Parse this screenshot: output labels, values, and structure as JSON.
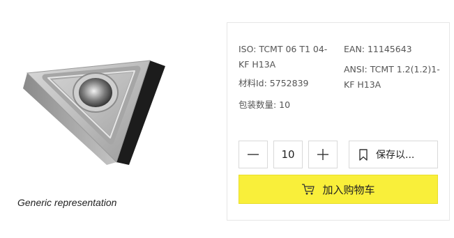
{
  "image": {
    "caption": "Generic representation"
  },
  "specs": {
    "iso": "ISO: TCMT 06 T1 04-KF H13A",
    "ean": "EAN: 11145643",
    "ansi": "ANSI: TCMT 1.2(1.2)1-KF H13A",
    "material_id": "材料Id: 5752839",
    "package_qty": "包装数量: 10"
  },
  "quantity": {
    "value": "10"
  },
  "actions": {
    "save_label": "保存以...",
    "add_to_cart_label": "加入购物车"
  },
  "colors": {
    "cart_button": "#f9ef3a",
    "border": "#d9d9d9"
  },
  "icons": {
    "minus": "minus-icon",
    "plus": "plus-icon",
    "bookmark": "bookmark-icon",
    "cart": "shopping-cart-icon"
  }
}
